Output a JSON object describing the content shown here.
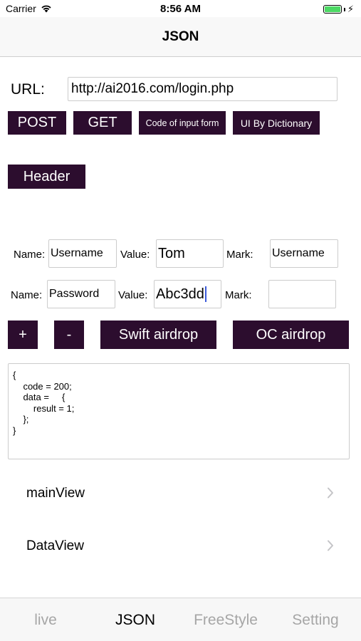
{
  "status_bar": {
    "carrier": "Carrier",
    "time": "8:56 AM",
    "battery_color": "#4cd964"
  },
  "nav": {
    "title": "JSON"
  },
  "url": {
    "label": "URL:",
    "value": "http://ai2016.com/login.php"
  },
  "actions": {
    "post": "POST",
    "get": "GET",
    "code_of_input_form": "Code of input form",
    "ui_by_dictionary": "UI By Dictionary",
    "header": "Header"
  },
  "params": [
    {
      "name_label": "Name:",
      "name_value": "Username",
      "value_label": "Value:",
      "value_value": "Tom",
      "mark_label": "Mark:",
      "mark_value": "Username"
    },
    {
      "name_label": "Name:",
      "name_value": "Password",
      "value_label": "Value:",
      "value_value": "Abc3dd",
      "mark_label": "Mark:",
      "mark_value": ""
    }
  ],
  "controls": {
    "add": "+",
    "remove": "-",
    "swift_airdrop": "Swift airdrop",
    "oc_airdrop": "OC airdrop"
  },
  "output": {
    "text": "{\n    code = 200;\n    data =     {\n        result = 1;\n    };\n}"
  },
  "rows": [
    {
      "label": "mainView"
    },
    {
      "label": "DataView"
    }
  ],
  "tabs": [
    {
      "label": "live",
      "active": false
    },
    {
      "label": "JSON",
      "active": true
    },
    {
      "label": "FreeStyle",
      "active": false
    },
    {
      "label": "Setting",
      "active": false
    }
  ],
  "colors": {
    "button_bg": "#2c0d2e",
    "button_text": "#ffffff",
    "tab_inactive": "#a6a6a6",
    "caret": "#3b5bdb"
  }
}
